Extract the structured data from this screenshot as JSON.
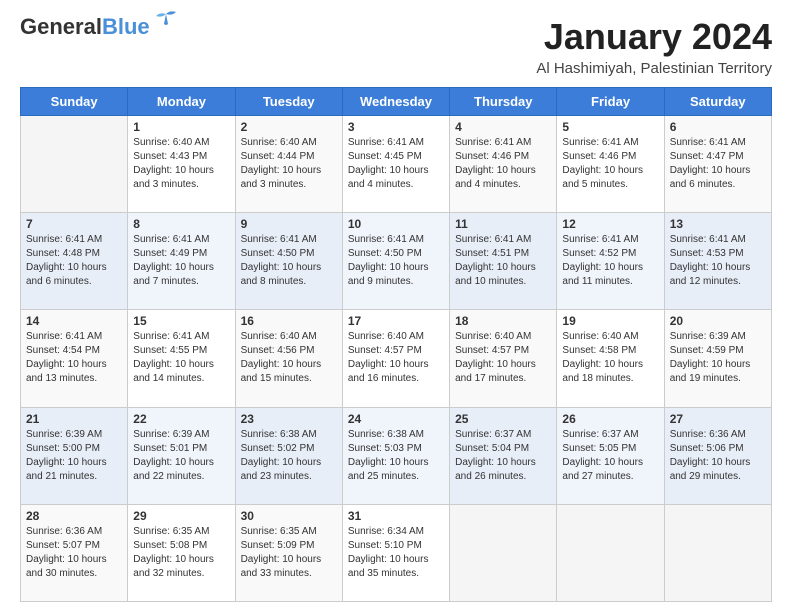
{
  "header": {
    "logo_line1": "General",
    "logo_line2": "Blue",
    "main_title": "January 2024",
    "subtitle": "Al Hashimiyah, Palestinian Territory"
  },
  "days_of_week": [
    "Sunday",
    "Monday",
    "Tuesday",
    "Wednesday",
    "Thursday",
    "Friday",
    "Saturday"
  ],
  "weeks": [
    [
      {
        "day": "",
        "sunrise": "",
        "sunset": "",
        "daylight": ""
      },
      {
        "day": "1",
        "sunrise": "Sunrise: 6:40 AM",
        "sunset": "Sunset: 4:43 PM",
        "daylight": "Daylight: 10 hours and 3 minutes."
      },
      {
        "day": "2",
        "sunrise": "Sunrise: 6:40 AM",
        "sunset": "Sunset: 4:44 PM",
        "daylight": "Daylight: 10 hours and 3 minutes."
      },
      {
        "day": "3",
        "sunrise": "Sunrise: 6:41 AM",
        "sunset": "Sunset: 4:45 PM",
        "daylight": "Daylight: 10 hours and 4 minutes."
      },
      {
        "day": "4",
        "sunrise": "Sunrise: 6:41 AM",
        "sunset": "Sunset: 4:46 PM",
        "daylight": "Daylight: 10 hours and 4 minutes."
      },
      {
        "day": "5",
        "sunrise": "Sunrise: 6:41 AM",
        "sunset": "Sunset: 4:46 PM",
        "daylight": "Daylight: 10 hours and 5 minutes."
      },
      {
        "day": "6",
        "sunrise": "Sunrise: 6:41 AM",
        "sunset": "Sunset: 4:47 PM",
        "daylight": "Daylight: 10 hours and 6 minutes."
      }
    ],
    [
      {
        "day": "7",
        "sunrise": "Sunrise: 6:41 AM",
        "sunset": "Sunset: 4:48 PM",
        "daylight": "Daylight: 10 hours and 6 minutes."
      },
      {
        "day": "8",
        "sunrise": "Sunrise: 6:41 AM",
        "sunset": "Sunset: 4:49 PM",
        "daylight": "Daylight: 10 hours and 7 minutes."
      },
      {
        "day": "9",
        "sunrise": "Sunrise: 6:41 AM",
        "sunset": "Sunset: 4:50 PM",
        "daylight": "Daylight: 10 hours and 8 minutes."
      },
      {
        "day": "10",
        "sunrise": "Sunrise: 6:41 AM",
        "sunset": "Sunset: 4:50 PM",
        "daylight": "Daylight: 10 hours and 9 minutes."
      },
      {
        "day": "11",
        "sunrise": "Sunrise: 6:41 AM",
        "sunset": "Sunset: 4:51 PM",
        "daylight": "Daylight: 10 hours and 10 minutes."
      },
      {
        "day": "12",
        "sunrise": "Sunrise: 6:41 AM",
        "sunset": "Sunset: 4:52 PM",
        "daylight": "Daylight: 10 hours and 11 minutes."
      },
      {
        "day": "13",
        "sunrise": "Sunrise: 6:41 AM",
        "sunset": "Sunset: 4:53 PM",
        "daylight": "Daylight: 10 hours and 12 minutes."
      }
    ],
    [
      {
        "day": "14",
        "sunrise": "Sunrise: 6:41 AM",
        "sunset": "Sunset: 4:54 PM",
        "daylight": "Daylight: 10 hours and 13 minutes."
      },
      {
        "day": "15",
        "sunrise": "Sunrise: 6:41 AM",
        "sunset": "Sunset: 4:55 PM",
        "daylight": "Daylight: 10 hours and 14 minutes."
      },
      {
        "day": "16",
        "sunrise": "Sunrise: 6:40 AM",
        "sunset": "Sunset: 4:56 PM",
        "daylight": "Daylight: 10 hours and 15 minutes."
      },
      {
        "day": "17",
        "sunrise": "Sunrise: 6:40 AM",
        "sunset": "Sunset: 4:57 PM",
        "daylight": "Daylight: 10 hours and 16 minutes."
      },
      {
        "day": "18",
        "sunrise": "Sunrise: 6:40 AM",
        "sunset": "Sunset: 4:57 PM",
        "daylight": "Daylight: 10 hours and 17 minutes."
      },
      {
        "day": "19",
        "sunrise": "Sunrise: 6:40 AM",
        "sunset": "Sunset: 4:58 PM",
        "daylight": "Daylight: 10 hours and 18 minutes."
      },
      {
        "day": "20",
        "sunrise": "Sunrise: 6:39 AM",
        "sunset": "Sunset: 4:59 PM",
        "daylight": "Daylight: 10 hours and 19 minutes."
      }
    ],
    [
      {
        "day": "21",
        "sunrise": "Sunrise: 6:39 AM",
        "sunset": "Sunset: 5:00 PM",
        "daylight": "Daylight: 10 hours and 21 minutes."
      },
      {
        "day": "22",
        "sunrise": "Sunrise: 6:39 AM",
        "sunset": "Sunset: 5:01 PM",
        "daylight": "Daylight: 10 hours and 22 minutes."
      },
      {
        "day": "23",
        "sunrise": "Sunrise: 6:38 AM",
        "sunset": "Sunset: 5:02 PM",
        "daylight": "Daylight: 10 hours and 23 minutes."
      },
      {
        "day": "24",
        "sunrise": "Sunrise: 6:38 AM",
        "sunset": "Sunset: 5:03 PM",
        "daylight": "Daylight: 10 hours and 25 minutes."
      },
      {
        "day": "25",
        "sunrise": "Sunrise: 6:37 AM",
        "sunset": "Sunset: 5:04 PM",
        "daylight": "Daylight: 10 hours and 26 minutes."
      },
      {
        "day": "26",
        "sunrise": "Sunrise: 6:37 AM",
        "sunset": "Sunset: 5:05 PM",
        "daylight": "Daylight: 10 hours and 27 minutes."
      },
      {
        "day": "27",
        "sunrise": "Sunrise: 6:36 AM",
        "sunset": "Sunset: 5:06 PM",
        "daylight": "Daylight: 10 hours and 29 minutes."
      }
    ],
    [
      {
        "day": "28",
        "sunrise": "Sunrise: 6:36 AM",
        "sunset": "Sunset: 5:07 PM",
        "daylight": "Daylight: 10 hours and 30 minutes."
      },
      {
        "day": "29",
        "sunrise": "Sunrise: 6:35 AM",
        "sunset": "Sunset: 5:08 PM",
        "daylight": "Daylight: 10 hours and 32 minutes."
      },
      {
        "day": "30",
        "sunrise": "Sunrise: 6:35 AM",
        "sunset": "Sunset: 5:09 PM",
        "daylight": "Daylight: 10 hours and 33 minutes."
      },
      {
        "day": "31",
        "sunrise": "Sunrise: 6:34 AM",
        "sunset": "Sunset: 5:10 PM",
        "daylight": "Daylight: 10 hours and 35 minutes."
      },
      {
        "day": "",
        "sunrise": "",
        "sunset": "",
        "daylight": ""
      },
      {
        "day": "",
        "sunrise": "",
        "sunset": "",
        "daylight": ""
      },
      {
        "day": "",
        "sunrise": "",
        "sunset": "",
        "daylight": ""
      }
    ]
  ]
}
